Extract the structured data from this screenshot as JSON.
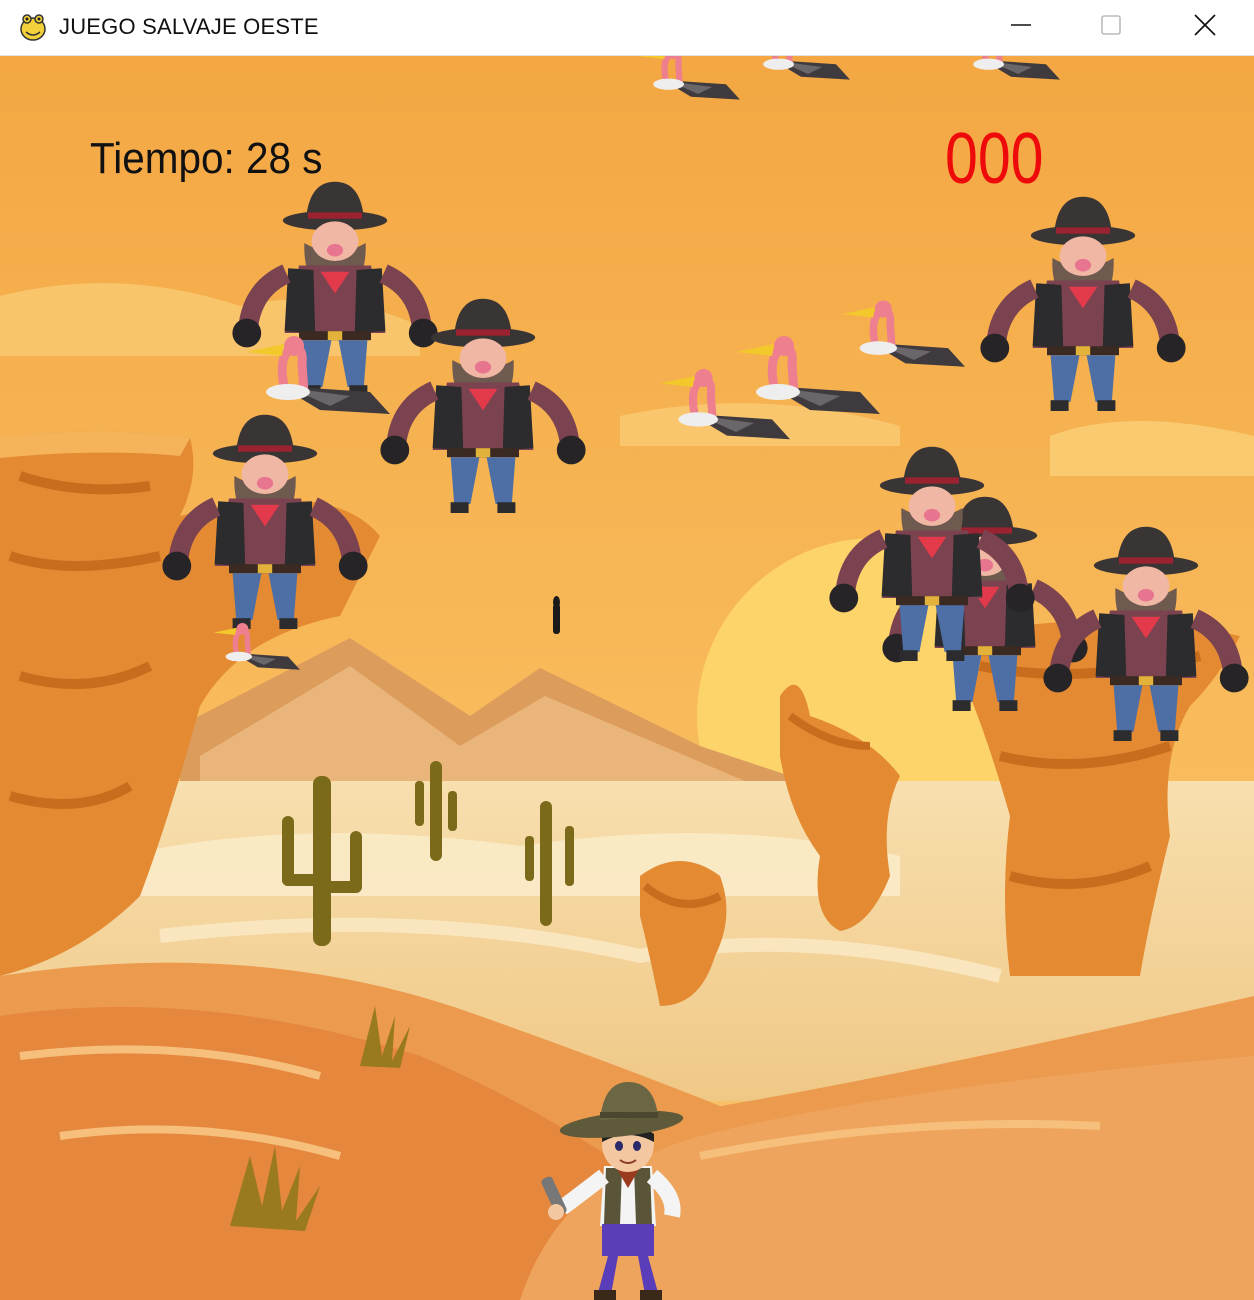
{
  "window": {
    "title": "JUEGO SALVAJE OESTE",
    "app_icon": "pygame-snake-icon",
    "controls": [
      "minimize-icon",
      "maximize-icon",
      "close-icon"
    ]
  },
  "hud": {
    "time_label": "Tiempo: 28 s",
    "score": "000",
    "score_color": "#ee0a0a"
  },
  "colors": {
    "sky": "#f5a94a",
    "sun": "#fcd46a",
    "rock": "#e38a32",
    "sand": "#f6d69a",
    "dune": "#ec9a4e"
  },
  "sprites": {
    "bandit": "bandit-sprite",
    "vulture": "vulture-sprite",
    "player": "cowboy-player-sprite",
    "bullet": "bullet-sprite"
  }
}
